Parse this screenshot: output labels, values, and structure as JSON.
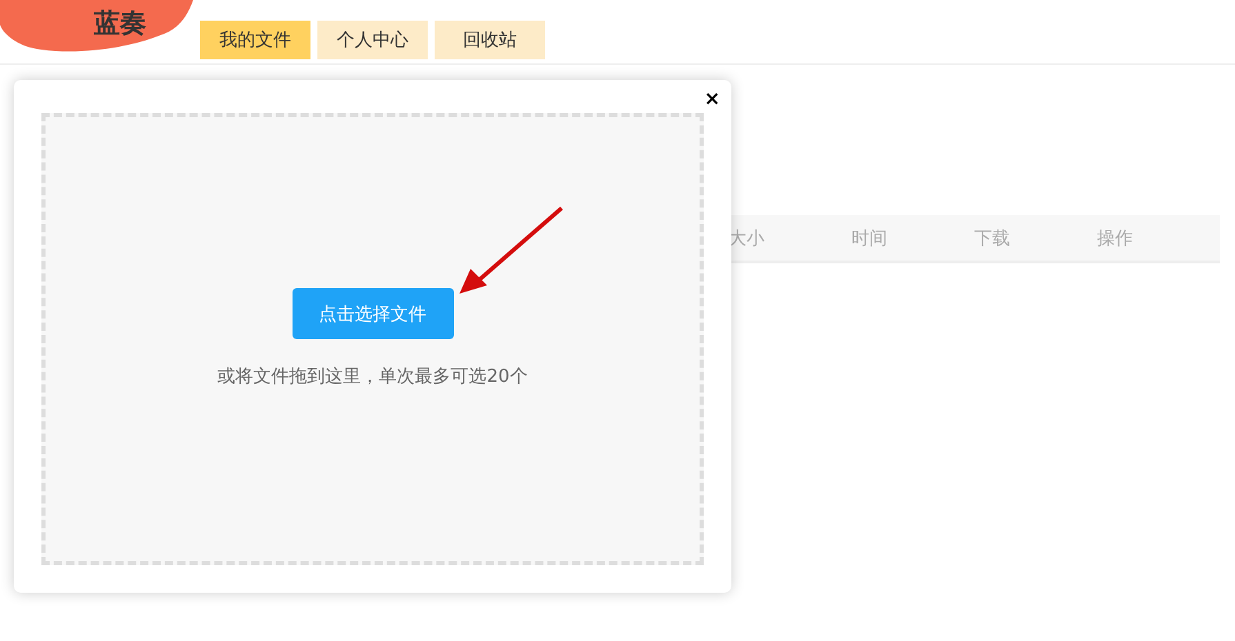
{
  "logo": {
    "text": "蓝奏"
  },
  "tabs": [
    {
      "label": "我的文件",
      "selected": true
    },
    {
      "label": "个人中心",
      "selected": false
    },
    {
      "label": "回收站",
      "selected": false
    }
  ],
  "table": {
    "columns": [
      "大小",
      "时间",
      "下载",
      "操作"
    ]
  },
  "dialog": {
    "close": "×",
    "button": "点击选择文件",
    "hint": "或将文件拖到这里，单次最多可选20个"
  }
}
